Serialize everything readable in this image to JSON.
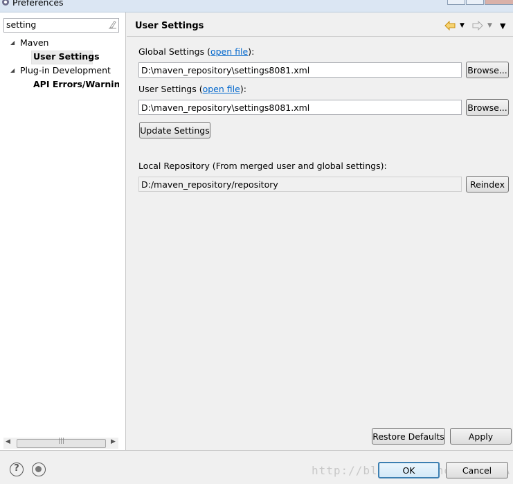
{
  "window": {
    "title": "Preferences"
  },
  "sidebar": {
    "filter_value": "setting",
    "tree": [
      {
        "label": "Maven",
        "children": [
          {
            "label": "User Settings",
            "selected": true
          }
        ]
      },
      {
        "label": "Plug-in Development",
        "children": [
          {
            "label": "API Errors/Warnings"
          }
        ]
      }
    ]
  },
  "page": {
    "title": "User Settings",
    "global_settings": {
      "label_prefix": "Global Settings (",
      "link": "open file",
      "label_suffix": "):",
      "value": "D:\\maven_repository\\settings8081.xml",
      "browse_label": "Browse..."
    },
    "user_settings": {
      "label_prefix": "User Settings (",
      "link": "open file",
      "label_suffix": "):",
      "value": "D:\\maven_repository\\settings8081.xml",
      "browse_label": "Browse..."
    },
    "update_label": "Update Settings",
    "local_repo": {
      "label": "Local Repository (From merged user and global settings):",
      "value": "D:/maven_repository/repository",
      "reindex_label": "Reindex"
    },
    "restore_label": "Restore Defaults",
    "apply_label": "Apply"
  },
  "footer": {
    "ok_label": "OK",
    "cancel_label": "Cancel",
    "watermark": "http://blog.csdn.net/CCCCKA"
  },
  "colors": {
    "link": "#0066cc",
    "nav_arrow": "#e2a21c",
    "default_button_border": "#3c7fb1"
  }
}
